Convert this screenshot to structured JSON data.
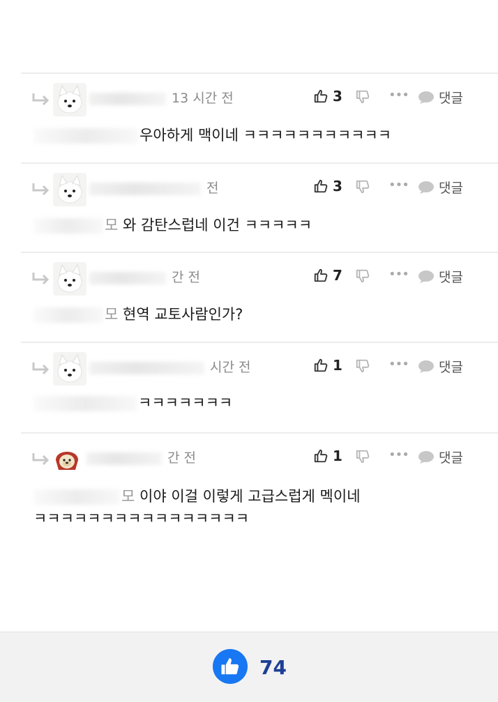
{
  "comments": [
    {
      "meta_time": "13 시간 전",
      "likes": "3",
      "reply_label": "댓글",
      "text": "우아하게 맥이네 ㅋㅋㅋㅋㅋㅋㅋㅋㅋㅋㅋ",
      "text_line2": "",
      "avatar": "white-dog-avatar"
    },
    {
      "meta_time": "전",
      "likes": "3",
      "reply_label": "댓글",
      "text": "와 감탄스럽네 이건 ㅋㅋㅋㅋㅋ",
      "text_prefix": "모",
      "text_line2": "",
      "avatar": "white-dog-avatar"
    },
    {
      "meta_time": "간 전",
      "likes": "7",
      "reply_label": "댓글",
      "text": "현역 교토사람인가?",
      "text_prefix": "모",
      "text_line2": "",
      "avatar": "white-dog-avatar"
    },
    {
      "meta_time": "시간 전",
      "likes": "1",
      "reply_label": "댓글",
      "text": "ㅋㅋㅋㅋㅋㅋㅋ",
      "text_line2": "",
      "avatar": "white-dog-avatar"
    },
    {
      "meta_time": "간 전",
      "likes": "1",
      "reply_label": "댓글",
      "text": "이야 이걸 이렇게 고급스럽게 멕이네",
      "text_prefix": "모",
      "text_line2": "ㅋㅋㅋㅋㅋㅋㅋㅋㅋㅋㅋㅋㅋㅋㅋㅋ",
      "avatar": "red-hood-dog-avatar"
    }
  ],
  "footer": {
    "total_likes": "74",
    "icon": "thumbs-up-icon"
  },
  "colors": {
    "accent_blue": "#1877f2",
    "count_navy": "#1d3f93"
  }
}
